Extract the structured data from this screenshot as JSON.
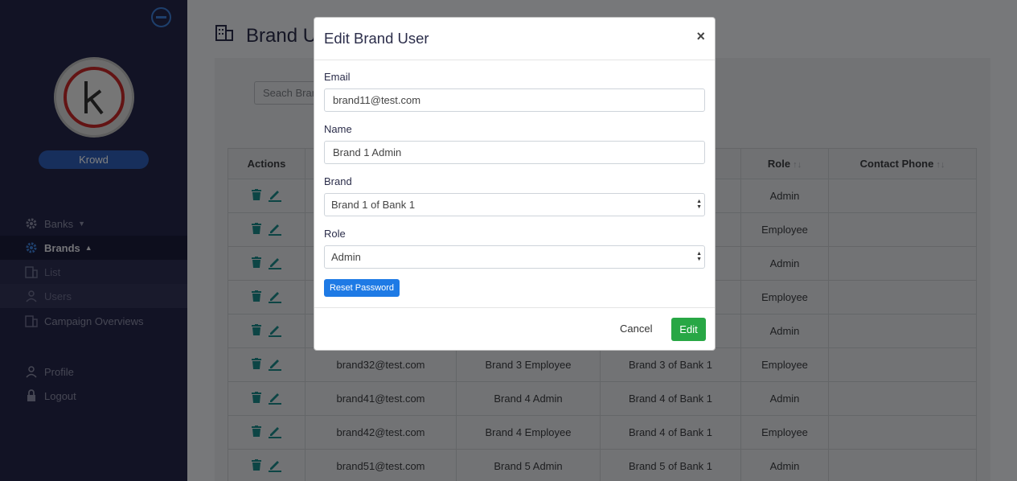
{
  "sidebar": {
    "user_name": "Krowd",
    "avatar_letter": "k",
    "nav": [
      {
        "label": "Banks",
        "icon": "gear-icon"
      },
      {
        "label": "Brands",
        "icon": "gear-icon"
      },
      {
        "label": "List",
        "icon": "building-icon"
      },
      {
        "label": "Users",
        "icon": "user-icon"
      },
      {
        "label": "Campaign Overviews",
        "icon": "building-icon"
      },
      {
        "label": "Profile",
        "icon": "user-icon"
      },
      {
        "label": "Logout",
        "icon": "lock-icon"
      }
    ]
  },
  "page": {
    "title": "Brand U",
    "search_placeholder": "Seach Bran"
  },
  "table": {
    "headers": [
      "Actions",
      "",
      "",
      "",
      "Role",
      "Contact Phone"
    ],
    "rows": [
      {
        "email": "",
        "name": "",
        "brand": "",
        "role": "Admin",
        "phone": ""
      },
      {
        "email": "",
        "name": "",
        "brand": "",
        "role": "Employee",
        "phone": ""
      },
      {
        "email": "",
        "name": "",
        "brand": "",
        "role": "Admin",
        "phone": ""
      },
      {
        "email": "",
        "name": "",
        "brand": "",
        "role": "Employee",
        "phone": ""
      },
      {
        "email": "",
        "name": "",
        "brand": "",
        "role": "Admin",
        "phone": ""
      },
      {
        "email": "brand32@test.com",
        "name": "Brand 3 Employee",
        "brand": "Brand 3 of Bank 1",
        "role": "Employee",
        "phone": ""
      },
      {
        "email": "brand41@test.com",
        "name": "Brand 4 Admin",
        "brand": "Brand 4 of Bank 1",
        "role": "Admin",
        "phone": ""
      },
      {
        "email": "brand42@test.com",
        "name": "Brand 4 Employee",
        "brand": "Brand 4 of Bank 1",
        "role": "Employee",
        "phone": ""
      },
      {
        "email": "brand51@test.com",
        "name": "Brand 5 Admin",
        "brand": "Brand 5 of Bank 1",
        "role": "Admin",
        "phone": ""
      }
    ]
  },
  "modal": {
    "title": "Edit Brand User",
    "close": "×",
    "email_label": "Email",
    "email_value": "brand11@test.com",
    "name_label": "Name",
    "name_value": "Brand 1 Admin",
    "brand_label": "Brand",
    "brand_value": "Brand 1 of Bank 1",
    "role_label": "Role",
    "role_value": "Admin",
    "reset_label": "Reset Password",
    "cancel_label": "Cancel",
    "edit_label": "Edit"
  },
  "colors": {
    "sidebar_bg": "#25274a",
    "accent_blue": "#1e7ae5",
    "edit_green": "#28a745",
    "action_icon": "#1a8a8a"
  }
}
